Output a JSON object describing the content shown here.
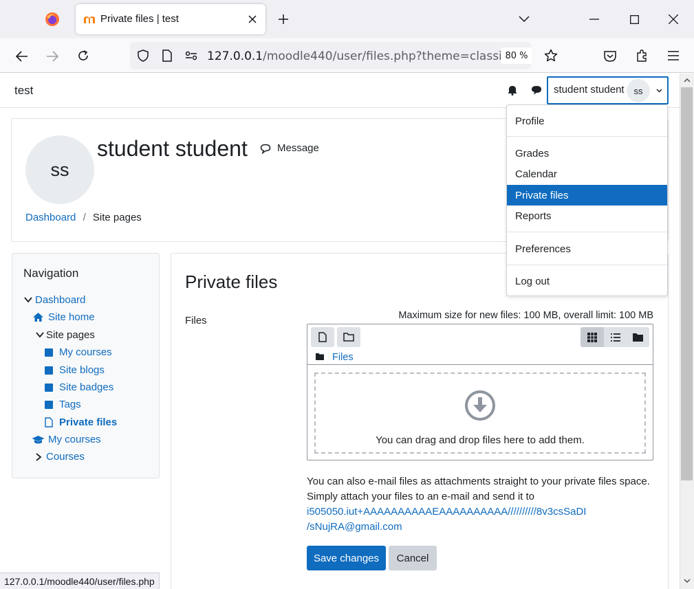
{
  "browser": {
    "tab_title": "Private files | test",
    "url_host": "127.0.0.1",
    "url_path": "/moodle440/user/files.php?theme=classic",
    "zoom": "80 %",
    "status_url": "127.0.0.1/moodle440/user/files.php"
  },
  "site": {
    "name": "test"
  },
  "user": {
    "name": "student student",
    "initials": "ss",
    "message_label": "Message"
  },
  "breadcrumb": {
    "items": [
      "Dashboard",
      "Site pages"
    ],
    "separator": "/"
  },
  "usermenu": {
    "items": [
      "Profile",
      "Grades",
      "Calendar",
      "Private files",
      "Reports",
      "Preferences",
      "Log out"
    ],
    "active": "Private files"
  },
  "navigation": {
    "title": "Navigation",
    "dashboard": "Dashboard",
    "site_home": "Site home",
    "site_pages": "Site pages",
    "children": [
      "My courses",
      "Site blogs",
      "Site badges",
      "Tags",
      "Private files"
    ],
    "my_courses": "My courses",
    "courses": "Courses"
  },
  "main": {
    "heading": "Private files",
    "files_label": "Files",
    "limits": "Maximum size for new files: 100 MB, overall limit: 100 MB",
    "folder_path": "Files",
    "drop_text": "You can drag and drop files here to add them.",
    "email_text_1": "You can also e-mail files as attachments straight to your private files space.",
    "email_text_2": "Simply attach your files to an e-mail and send it to",
    "email_address_1": "i505050.iut+AAAAAAAAAAEAAAAAAAAAA//////////8v3csSaDI",
    "email_address_2": "/sNujRA@gmail.com",
    "save_label": "Save changes",
    "cancel_label": "Cancel"
  },
  "colors": {
    "accent": "#0f6cbf",
    "active_menu": "#0f6cbf",
    "cancel_bg": "#ced4da"
  }
}
